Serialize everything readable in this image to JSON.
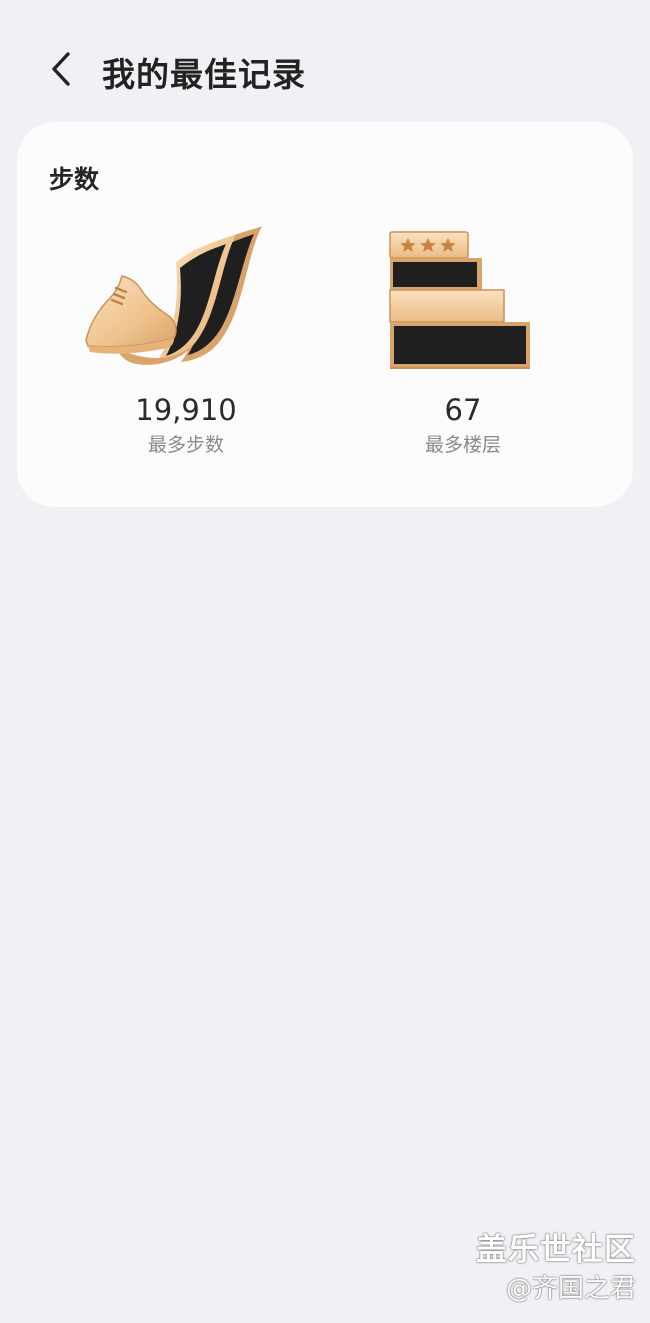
{
  "header": {
    "title": "我的最佳记录"
  },
  "steps_card": {
    "title": "步数",
    "max_steps": {
      "value": "19,910",
      "label": "最多步数",
      "icon": "running-shoe-badge-icon"
    },
    "max_floors": {
      "value": "67",
      "label": "最多楼层",
      "icon": "stairs-stars-badge-icon"
    }
  },
  "watermark": {
    "line1": "盖乐世社区",
    "line2": "@齐国之君"
  },
  "colors": {
    "background": "#f1f1f5",
    "card": "#fcfcfc",
    "badge_gold": "#f2c99a",
    "badge_dark": "#222222"
  }
}
